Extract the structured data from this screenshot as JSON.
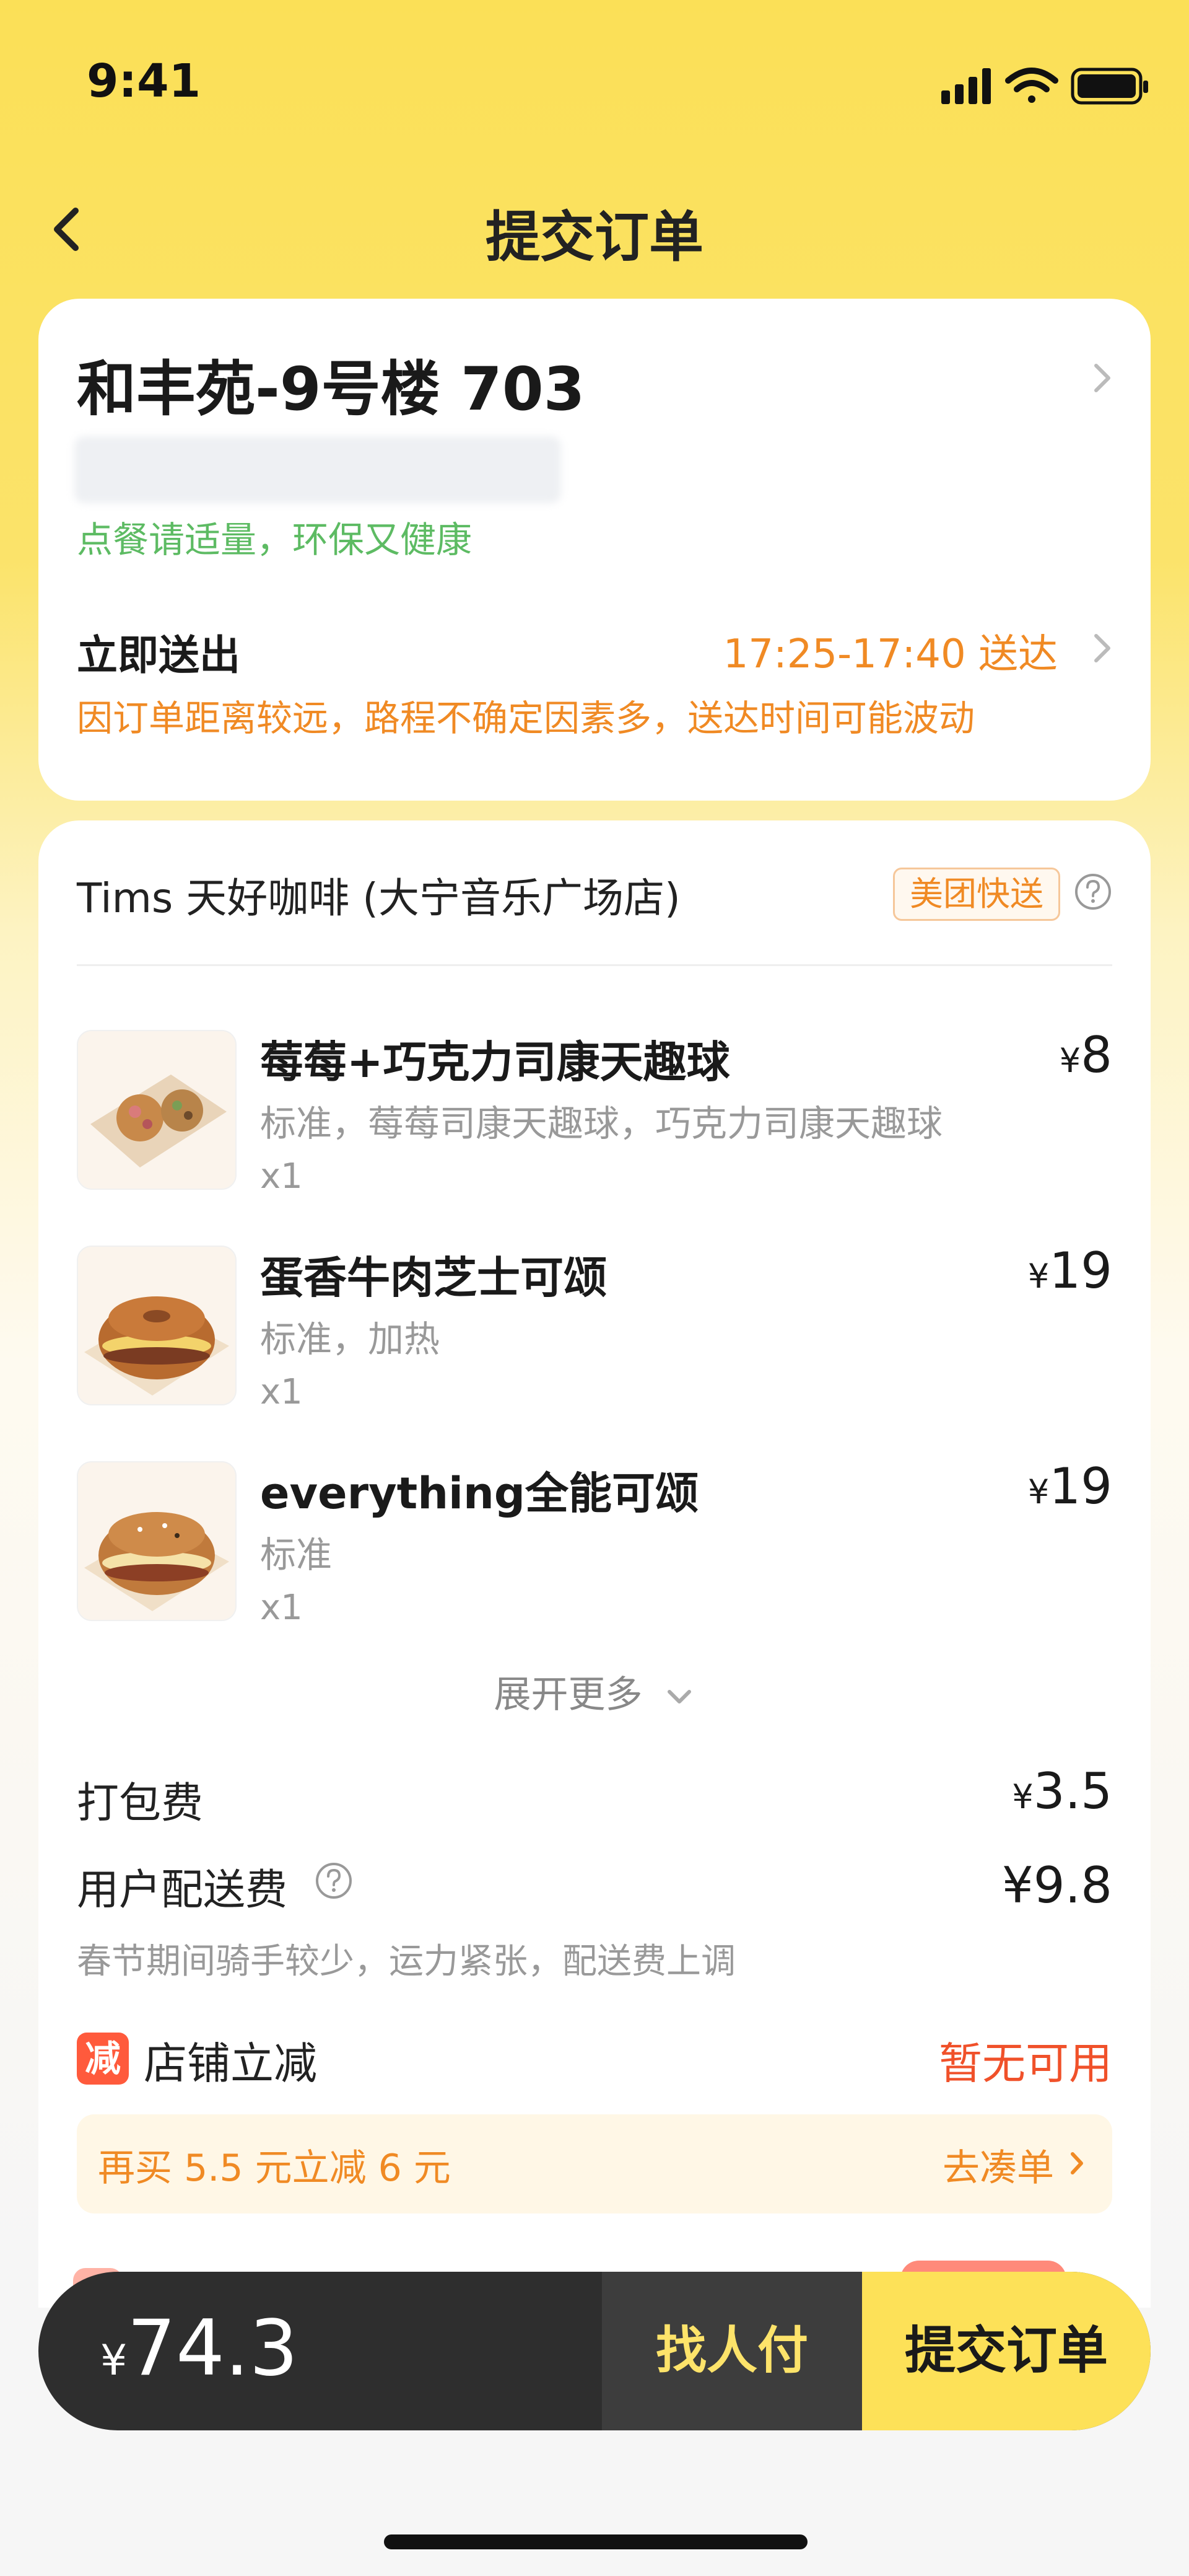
{
  "status_bar": {
    "time": "9:41"
  },
  "nav": {
    "title": "提交订单"
  },
  "address": {
    "title": "和丰苑-9号楼 703",
    "eco_tip": "点餐请适量，环保又健康",
    "deliver_now": "立即送出",
    "deliver_time": "17:25-17:40 送达",
    "deliver_note": "因订单距离较远，路程不确定因素多，送达时间可能波动"
  },
  "shop": {
    "name": "Tims 天好咖啡 (大宁音乐广场店)",
    "badge": "美团快送"
  },
  "items": [
    {
      "name": "莓莓+巧克力司康天趣球",
      "spec": "标准，莓莓司康天趣球，巧克力司康天趣球",
      "qty": "x1",
      "price_symbol": "¥",
      "price": "8"
    },
    {
      "name": "蛋香牛肉芝士可颂",
      "spec": "标准，加热",
      "qty": "x1",
      "price_symbol": "¥",
      "price": "19"
    },
    {
      "name": "everything全能可颂",
      "spec": "标准",
      "qty": "x1",
      "price_symbol": "¥",
      "price": "19"
    }
  ],
  "expand_label": "展开更多",
  "fees": {
    "packing_label": "打包费",
    "packing_symbol": "¥",
    "packing_value": "3.5",
    "delivery_label": "用户配送费",
    "delivery_value": "¥9.8",
    "delivery_note": "春节期间骑手较少，运力紧张，配送费上调"
  },
  "discount": {
    "icon_text": "减",
    "label": "店铺立减",
    "value": "暂无可用",
    "promo_text": "再买 5.5 元立减 6 元",
    "promo_link": "去凑单"
  },
  "bottom_bar": {
    "currency": "¥",
    "total": "74.3",
    "find_pay": "找人付",
    "submit": "提交订单"
  },
  "colors": {
    "brand_yellow": "#fde158",
    "orange": "#f08a24",
    "green": "#5dbb63",
    "red": "#f0512a"
  }
}
